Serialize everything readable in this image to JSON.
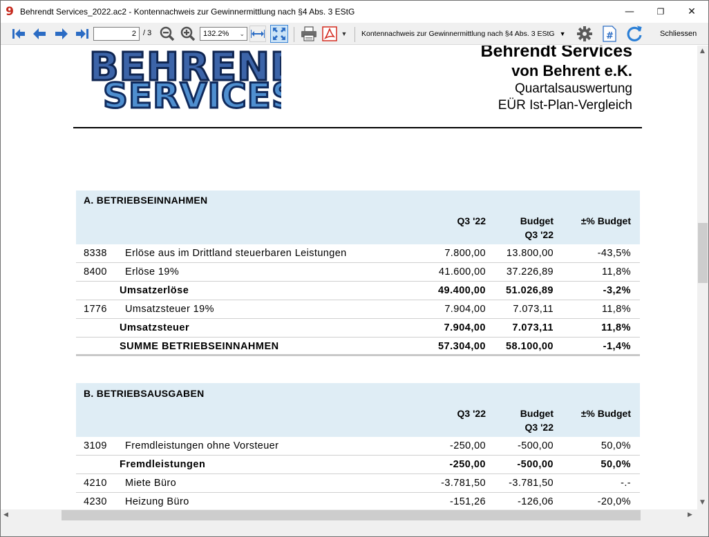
{
  "window": {
    "title": "Behrendt Services_2022.ac2 - Kontennachweis zur Gewinnermittlung nach §4 Abs. 3 EStG",
    "app_icon_glyph": "9",
    "minimize_glyph": "—",
    "maximize_glyph": "❐",
    "close_glyph": "✕"
  },
  "toolbar": {
    "page_current": "2",
    "page_total": "/ 3",
    "zoom": "132.2%",
    "report_select": "Kontennachweis zur Gewinnermittlung nach §4 Abs. 3 EStG",
    "close_label": "Schliessen",
    "icons": [
      "first-page-icon",
      "prev-page-icon",
      "next-page-icon",
      "last-page-icon",
      "zoom-out-icon",
      "zoom-in-icon",
      "fit-width-icon",
      "fit-page-icon",
      "print-icon",
      "pdf-icon",
      "settings-gear-icon",
      "numbering-icon",
      "refresh-icon"
    ]
  },
  "colors": {
    "accent_blue": "#2b6cc4",
    "section_bg": "#dfedf5",
    "logo_dark": "#1f3f7a",
    "logo_light": "#4f8fd0",
    "pdf_red": "#d42a1f"
  },
  "report": {
    "logo_line1": "BEHRENDT",
    "logo_line2": "SERVICES",
    "company_line1": "Behrendt Services",
    "company_line2": "von Behrent e.K.",
    "subtitle1": "Quartalsauswertung",
    "subtitle2": "EÜR Ist-Plan-Vergleich",
    "columns": {
      "q": "Q3 '22",
      "budget_l1": "Budget",
      "budget_l2": "Q3 '22",
      "pct": "±% Budget"
    },
    "section_a": {
      "title": "A. BETRIEBSEINNAHMEN",
      "rows": [
        {
          "acct": "8338",
          "name": "Erlöse aus im Drittland steuerbaren Leistungen",
          "q": "7.800,00",
          "budget": "13.800,00",
          "pct": "-43,5%"
        },
        {
          "acct": "8400",
          "name": "Erlöse 19%",
          "q": "41.600,00",
          "budget": "37.226,89",
          "pct": "11,8%"
        },
        {
          "acct": "",
          "name": "Umsatzerlöse",
          "q": "49.400,00",
          "budget": "51.026,89",
          "pct": "-3,2%"
        },
        {
          "acct": "1776",
          "name": "Umsatzsteuer 19%",
          "q": "7.904,00",
          "budget": "7.073,11",
          "pct": "11,8%"
        },
        {
          "acct": "",
          "name": "Umsatzsteuer",
          "q": "7.904,00",
          "budget": "7.073,11",
          "pct": "11,8%"
        },
        {
          "acct": "",
          "name": "SUMME BETRIEBSEINNAHMEN",
          "q": "57.304,00",
          "budget": "58.100,00",
          "pct": "-1,4%"
        }
      ]
    },
    "section_b": {
      "title": "B. BETRIEBSAUSGABEN",
      "rows": [
        {
          "acct": "3109",
          "name": "Fremdleistungen ohne Vorsteuer",
          "q": "-250,00",
          "budget": "-500,00",
          "pct": "50,0%"
        },
        {
          "acct": "",
          "name": "Fremdleistungen",
          "q": "-250,00",
          "budget": "-500,00",
          "pct": "50,0%"
        },
        {
          "acct": "4210",
          "name": "Miete Büro",
          "q": "-3.781,50",
          "budget": "-3.781,50",
          "pct": "-.-"
        },
        {
          "acct": "4230",
          "name": "Heizung Büro",
          "q": "-151,26",
          "budget": "-126,06",
          "pct": "-20,0%"
        }
      ]
    }
  },
  "scrollbars": {
    "up": "▲",
    "down": "▼",
    "left": "◀",
    "right": "▶"
  }
}
